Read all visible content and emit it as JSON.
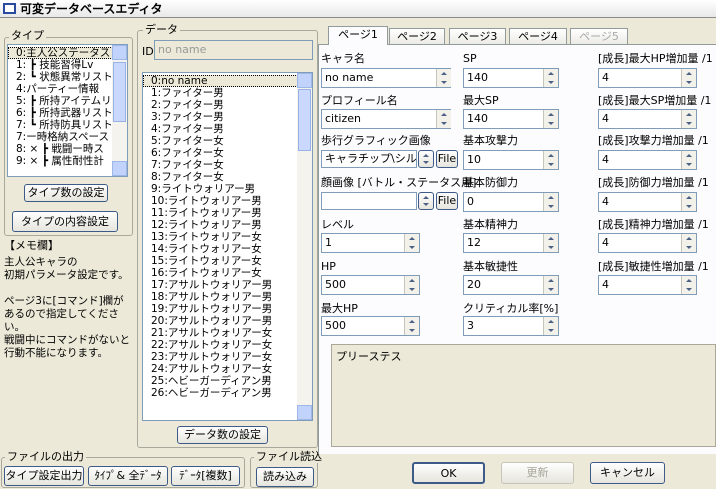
{
  "window": {
    "title": "可変データベースエディタ"
  },
  "type_panel": {
    "label": "タイプ",
    "items": [
      "0:主人公ステータス",
      "1: ┣ 技能習得Lv",
      "2: ┗ 状態異常リスト",
      "4:パーティー情報",
      "5: ┣ 所持アイテムリスト",
      "6: ┣ 所持武器リスト",
      "7: ┗ 所持防具リスト",
      "7:ー時格納スペース",
      "8: × ┣ 戦闘ー時ス",
      "9: × ┣ 属性耐性計"
    ],
    "count_button": "タイプ数の設定",
    "content_button": "タイプの内容設定"
  },
  "memo": {
    "label": "【メモ欄】",
    "text": "主人公キャラの\n初期パラメータ設定です。\n\nページ3に[コマンド]欄が\nあるので指定してください。\n戦闘中にコマンドがないと\n行動不能になります。"
  },
  "file_output": {
    "label": "ファイルの出力",
    "type_settings": "タイプ設定出力",
    "type_all_data": "ﾀｲﾌﾟ& 全ﾃﾞｰﾀ",
    "data_multiple": "ﾃﾞｰﾀ[複数]"
  },
  "file_read": {
    "label": "ファイル読込",
    "load_button": "読み込み"
  },
  "data_panel": {
    "label": "データ",
    "id_label": "ID",
    "name_placeholder": "no name",
    "count_button": "データ数の設定",
    "items": [
      "0:no name",
      "1:ファイター男",
      "2:ファイター男",
      "3:ファイター男",
      "4:ファイター男",
      "5:ファイター女",
      "6:ファイター女",
      "7:ファイター女",
      "8:ファイター女",
      "9:ライトウォリアー男",
      "10:ライトウォリアー男",
      "11:ライトウォリアー男",
      "12:ライトウォリアー男",
      "13:ライトウォリアー女",
      "14:ライトウォリアー女",
      "15:ライトウォリアー女",
      "16:ライトウォリアー女",
      "17:アサルトウォリアー男",
      "18:アサルトウォリアー男",
      "19:アサルトウォリアー男",
      "20:アサルトウォリアー男",
      "21:アサルトウォリアー女",
      "22:アサルトウォリアー女",
      "23:アサルトウォリアー女",
      "24:アサルトウォリアー女",
      "25:ヘビーガーディアン男",
      "26:ヘビーガーディアン男"
    ]
  },
  "tabs": [
    "ページ1",
    "ページ2",
    "ページ3",
    "ページ4",
    "ページ5"
  ],
  "fields": {
    "chara_name": {
      "label": "キャラ名",
      "value": "no name"
    },
    "profile": {
      "label": "プロフィール名",
      "value": "citizen"
    },
    "walk_graphic": {
      "label": "歩行グラフィック画像",
      "value": "キャラチップ\\シルエット",
      "button": "File"
    },
    "face": {
      "label": "顔画像 [バトル・ステータス用]",
      "value": "",
      "button": "File"
    },
    "level": {
      "label": "レベル",
      "value": "1"
    },
    "hp": {
      "label": "HP",
      "value": "500"
    },
    "max_hp": {
      "label": "最大HP",
      "value": "500"
    },
    "sp": {
      "label": "SP",
      "value": "140"
    },
    "max_sp": {
      "label": "最大SP",
      "value": "140"
    },
    "attack": {
      "label": "基本攻撃力",
      "value": "10"
    },
    "defense": {
      "label": "基本防御力",
      "value": "0"
    },
    "mind": {
      "label": "基本精神力",
      "value": "12"
    },
    "agility": {
      "label": "基本敏捷性",
      "value": "20"
    },
    "critical": {
      "label": "クリティカル率[%]",
      "value": "3"
    },
    "g_hp": {
      "label": "[成長]最大HP増加量 /1",
      "value": "4"
    },
    "g_sp": {
      "label": "[成長]最大SP増加量 /1",
      "value": "4"
    },
    "g_atk": {
      "label": "[成長]攻撃力増加量 /1",
      "value": "4"
    },
    "g_def": {
      "label": "[成長]防御力増加量 /1",
      "value": "4"
    },
    "g_mind": {
      "label": "[成長]精神力増加量 /1",
      "value": "4"
    },
    "g_agi": {
      "label": "[成長]敏捷性増加量 /1",
      "value": "4"
    }
  },
  "preview_text": "プリーステス",
  "buttons": {
    "ok": "OK",
    "update": "更新",
    "cancel": "キャンセル"
  }
}
